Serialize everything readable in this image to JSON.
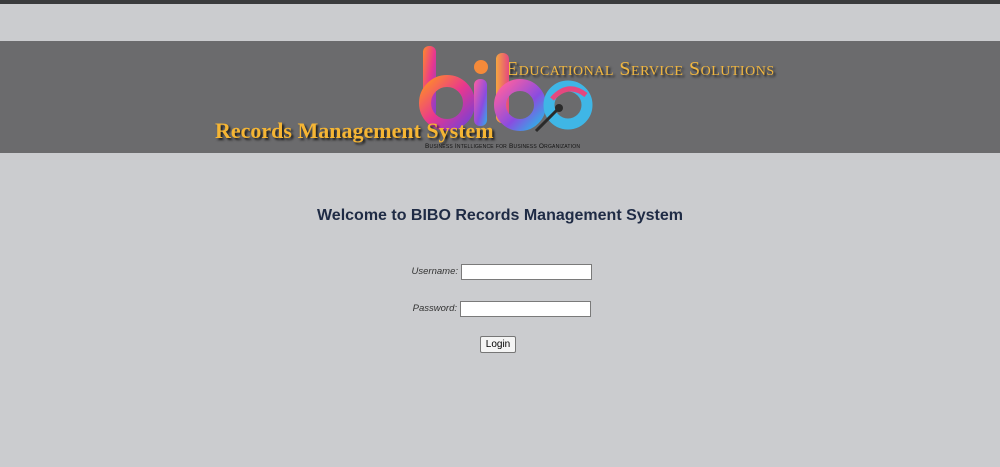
{
  "banner": {
    "tagline": "Educational Service Solutions",
    "system_name": "Records Management System",
    "logo_text": "bibo",
    "sub_tagline": "Business Intelligence for Business Organization"
  },
  "login": {
    "welcome": "Welcome to BIBO Records Management System",
    "username_label": "Username:",
    "username_value": "",
    "password_label": "Password:",
    "password_value": "",
    "login_button": "Login"
  },
  "colors": {
    "page_background": "#cbcccf",
    "banner_background": "#6b6b6d",
    "banner_title": "#f5b534",
    "welcome_text": "#1f2b45"
  }
}
